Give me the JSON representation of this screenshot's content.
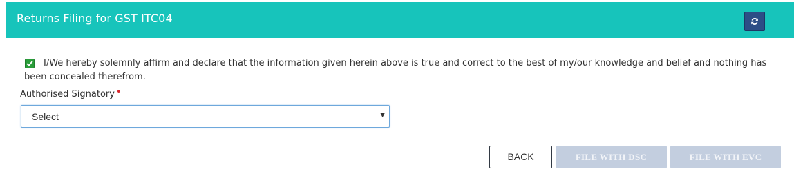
{
  "header": {
    "title": "Returns Filing for GST ITC04",
    "refresh_icon": "refresh-icon"
  },
  "declaration": {
    "checked": true,
    "checkbox_icon": "check-icon",
    "text": "I/We hereby solemnly affirm and declare that the information given herein above is true and correct to the best of my/our knowledge and belief and nothing has been concealed therefrom."
  },
  "signatory": {
    "label": "Authorised Signatory",
    "required_marker": "•",
    "selected": "Select",
    "arrow": "▼"
  },
  "buttons": {
    "back": "BACK",
    "file_dsc": "FILE WITH DSC",
    "file_evc": "FILE WITH EVC"
  },
  "colors": {
    "header_bg": "#17c4bb",
    "refresh_bg": "#2c4e86",
    "checkbox_bg": "#2a9d3a",
    "required": "#d9262c",
    "disabled_btn": "#c3cedf"
  }
}
